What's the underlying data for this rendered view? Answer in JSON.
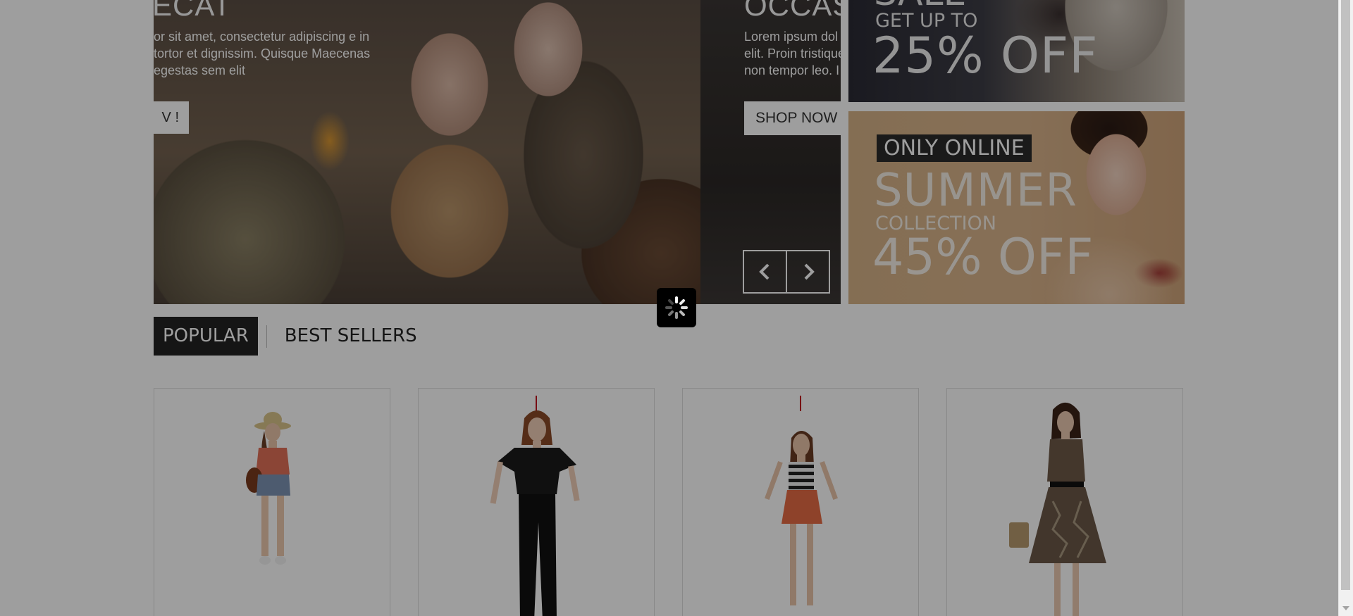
{
  "slider": {
    "slide1": {
      "title": "ECAT",
      "description": "or sit amet, consectetur adipiscing e in tortor et dignissim. Quisque Maecenas egestas sem elit",
      "button_label": "V !"
    },
    "slide2": {
      "title": "OCCAS",
      "description_line1": "Lorem ipsum dol",
      "description_line2": "elit. Proin tristique",
      "description_line3": "non tempor leo. I",
      "button_label": "SHOP NOW"
    },
    "prev_icon": "chevron-left-icon",
    "next_icon": "chevron-right-icon"
  },
  "banners": [
    {
      "sale": "SALE",
      "get_up_to": "GET UP TO",
      "discount": "25% OFF"
    },
    {
      "tag": "ONLY ONLINE",
      "headline": "SUMMER",
      "subline": "COLLECTION",
      "discount": "45% OFF"
    }
  ],
  "tabs": [
    {
      "label": "POPULAR",
      "active": true
    },
    {
      "label": "BEST SELLERS",
      "active": false
    }
  ],
  "products": [
    {
      "outfit": "hat-coral-top-denim-shorts",
      "has_marker": false
    },
    {
      "outfit": "black-top-black-pants",
      "has_marker": true
    },
    {
      "outfit": "striped-top-orange-skirt",
      "has_marker": true
    },
    {
      "outfit": "floral-dress",
      "has_marker": false
    }
  ],
  "loading_indicator": {
    "icon": "spinner-icon"
  },
  "colors": {
    "overlay": "rgba(0,0,0,0.38)",
    "marker": "#c1121f",
    "tab_active_bg": "#222222"
  }
}
